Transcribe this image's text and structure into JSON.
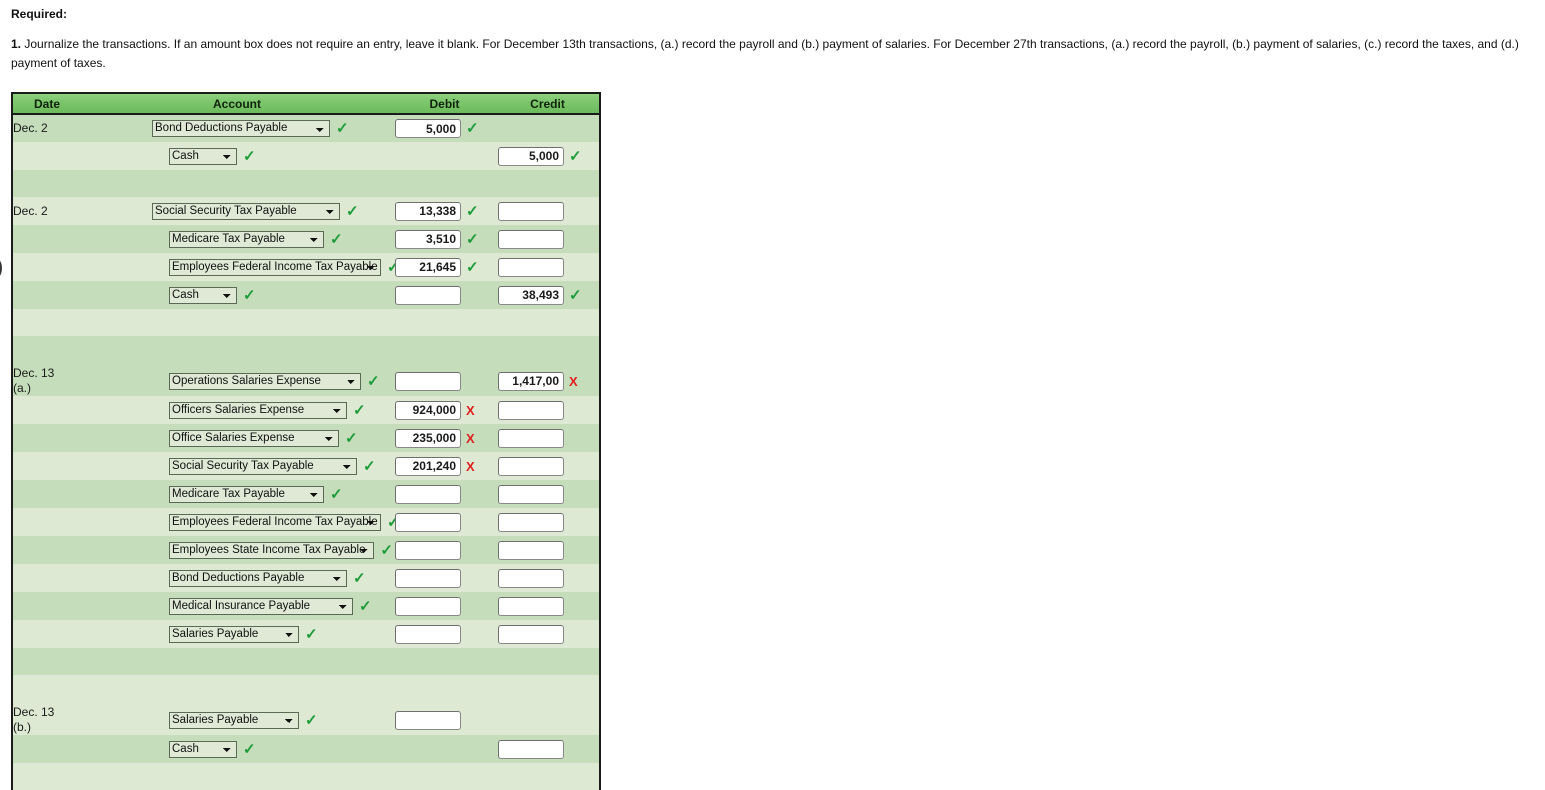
{
  "instructions": {
    "required_label": "Required:",
    "item_number": "1.",
    "item_text": "Journalize the transactions. If an amount box does not require an entry, leave it blank. For December 13th transactions, (a.) record the payroll and (b.) payment of salaries. For December 27th transactions, (a.) record the payroll, (b.) payment of salaries, (c.) record the taxes, and (d.) payment of taxes."
  },
  "left_clipped_glyph": ")",
  "colors": {
    "header_green_top": "#8ed07e",
    "header_green_bottom": "#6cbb5c",
    "row_band_dark": "#c5ddbb",
    "row_band_light": "#dde9d3",
    "check_green": "#1f9c3a",
    "x_red": "#e02020",
    "table_border": "#1b1b1b"
  },
  "journal": {
    "columns": [
      "Date",
      "Account",
      "Debit",
      "Credit"
    ],
    "rows": [
      {
        "kind": "entry",
        "band": "a",
        "date": "Dec. 2",
        "date_sub": "",
        "indent": 0,
        "account": "Bond Deductions Payable",
        "account_width": 178,
        "account_mark": "check",
        "debit": "5,000",
        "debit_mark": "check",
        "credit": "",
        "credit_mark": "none"
      },
      {
        "kind": "entry",
        "band": "b",
        "date": "",
        "date_sub": "",
        "indent": 1,
        "account": "Cash",
        "account_width": 68,
        "account_mark": "check",
        "debit": "",
        "debit_mark": "none",
        "credit": "5,000",
        "credit_mark": "check"
      },
      {
        "kind": "spacer",
        "band": "a"
      },
      {
        "kind": "entry",
        "band": "b",
        "date": "Dec. 2",
        "date_sub": "",
        "indent": 0,
        "account": "Social Security Tax Payable",
        "account_width": 188,
        "account_mark": "check",
        "debit": "13,338",
        "debit_mark": "check",
        "credit": "",
        "credit_mark": "blank"
      },
      {
        "kind": "entry",
        "band": "a",
        "date": "",
        "date_sub": "",
        "indent": 1,
        "account": "Medicare Tax Payable",
        "account_width": 155,
        "account_mark": "check",
        "debit": "3,510",
        "debit_mark": "check",
        "credit": "",
        "credit_mark": "blank"
      },
      {
        "kind": "entry",
        "band": "b",
        "date": "",
        "date_sub": "",
        "indent": 1,
        "account": "Employees Federal Income Tax Payable",
        "account_width": 249,
        "account_mark": "check",
        "debit": "21,645",
        "debit_mark": "check",
        "credit": "",
        "credit_mark": "blank"
      },
      {
        "kind": "entry",
        "band": "a",
        "date": "",
        "date_sub": "",
        "indent": 1,
        "account": "Cash",
        "account_width": 68,
        "account_mark": "check",
        "debit": "",
        "debit_mark": "blank",
        "credit": "38,493",
        "credit_mark": "check"
      },
      {
        "kind": "spacer",
        "band": "b"
      },
      {
        "kind": "spacer",
        "band": "a",
        "tall": true
      },
      {
        "kind": "entry",
        "band": "a",
        "date": "Dec. 13",
        "date_sub": "(a.)",
        "indent": 1,
        "account": "Operations Salaries Expense",
        "account_width": 192,
        "account_mark": "check",
        "debit": "",
        "debit_mark": "blank",
        "credit": "1,417,00",
        "credit_mark": "x"
      },
      {
        "kind": "entry",
        "band": "b",
        "date": "",
        "date_sub": "",
        "indent": 1,
        "account": "Officers Salaries Expense",
        "account_width": 178,
        "account_mark": "check",
        "debit": "924,000",
        "debit_mark": "x",
        "credit": "",
        "credit_mark": "blank"
      },
      {
        "kind": "entry",
        "band": "a",
        "date": "",
        "date_sub": "",
        "indent": 1,
        "account": "Office Salaries Expense",
        "account_width": 170,
        "account_mark": "check",
        "debit": "235,000",
        "debit_mark": "x",
        "credit": "",
        "credit_mark": "blank"
      },
      {
        "kind": "entry",
        "band": "b",
        "date": "",
        "date_sub": "",
        "indent": 1,
        "account": "Social Security Tax Payable",
        "account_width": 188,
        "account_mark": "check",
        "debit": "201,240",
        "debit_mark": "x",
        "credit": "",
        "credit_mark": "blank"
      },
      {
        "kind": "entry",
        "band": "a",
        "date": "",
        "date_sub": "",
        "indent": 1,
        "account": "Medicare Tax Payable",
        "account_width": 155,
        "account_mark": "check",
        "debit": "",
        "debit_mark": "blank",
        "credit": "",
        "credit_mark": "blank"
      },
      {
        "kind": "entry",
        "band": "b",
        "date": "",
        "date_sub": "",
        "indent": 1,
        "account": "Employees Federal Income Tax Payable",
        "account_width": 249,
        "account_mark": "check",
        "debit": "",
        "debit_mark": "blank",
        "credit": "",
        "credit_mark": "blank"
      },
      {
        "kind": "entry",
        "band": "a",
        "date": "",
        "date_sub": "",
        "indent": 1,
        "account": "Employees State Income Tax Payable",
        "account_width": 239,
        "account_mark": "check",
        "debit": "",
        "debit_mark": "blank",
        "credit": "",
        "credit_mark": "blank"
      },
      {
        "kind": "entry",
        "band": "b",
        "date": "",
        "date_sub": "",
        "indent": 1,
        "account": "Bond Deductions Payable",
        "account_width": 178,
        "account_mark": "check",
        "debit": "",
        "debit_mark": "blank",
        "credit": "",
        "credit_mark": "blank"
      },
      {
        "kind": "entry",
        "band": "a",
        "date": "",
        "date_sub": "",
        "indent": 1,
        "account": "Medical Insurance Payable",
        "account_width": 184,
        "account_mark": "check",
        "debit": "",
        "debit_mark": "blank",
        "credit": "",
        "credit_mark": "blank"
      },
      {
        "kind": "entry",
        "band": "b",
        "date": "",
        "date_sub": "",
        "indent": 1,
        "account": "Salaries Payable",
        "account_width": 130,
        "account_mark": "check",
        "debit": "",
        "debit_mark": "blank",
        "credit": "",
        "credit_mark": "blank"
      },
      {
        "kind": "spacer",
        "band": "a"
      },
      {
        "kind": "spacer",
        "band": "b",
        "tall": true
      },
      {
        "kind": "entry",
        "band": "b",
        "date": "Dec. 13",
        "date_sub": "(b.)",
        "indent": 1,
        "account": "Salaries Payable",
        "account_width": 130,
        "account_mark": "check",
        "debit": "",
        "debit_mark": "blank",
        "credit": "",
        "credit_mark": "none"
      },
      {
        "kind": "entry",
        "band": "a",
        "date": "",
        "date_sub": "",
        "indent": 1,
        "account": "Cash",
        "account_width": 68,
        "account_mark": "check",
        "debit": "",
        "debit_mark": "none",
        "credit": "",
        "credit_mark": "blank"
      },
      {
        "kind": "spacer",
        "band": "b"
      }
    ]
  }
}
